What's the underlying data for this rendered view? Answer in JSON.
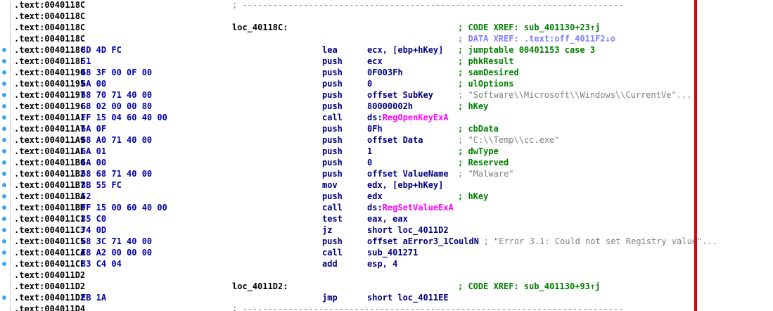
{
  "colors": {
    "address": "#000000",
    "bytes": "#0000aa",
    "instruction": "#000080",
    "api_name": "#ff00ff",
    "comment": "#008000",
    "string_comment": "#808080",
    "marker_dot": "#3aa6ee",
    "right_border": "#e00000"
  },
  "lines": [
    {
      "addr": ".text:0040118C",
      "sep": "; ---------------------------------------------------------------------------"
    },
    {
      "addr": ".text:0040118C"
    },
    {
      "addr": ".text:0040118C",
      "label": "loc_40118C:",
      "comment": "; CODE XREF: sub_401130+23↑j"
    },
    {
      "addr": ".text:0040118C",
      "comment": "; DATA XREF: .text:off_4011F2↓o",
      "comment_style": "xref"
    },
    {
      "addr": ".text:0040118C",
      "dot": true,
      "bytes": "8D 4D FC",
      "mnem": "lea",
      "ops": "ecx, [ebp+hKey]",
      "comment": "; jumptable 00401153 case 3"
    },
    {
      "addr": ".text:0040118F",
      "dot": true,
      "bytes": "51",
      "mnem": "push",
      "ops": "ecx",
      "comment": "; phkResult"
    },
    {
      "addr": ".text:00401190",
      "dot": true,
      "bytes": "68 3F 00 0F 00",
      "mnem": "push",
      "ops": "0F003Fh",
      "comment": "; samDesired"
    },
    {
      "addr": ".text:00401195",
      "dot": true,
      "bytes": "6A 00",
      "mnem": "push",
      "ops": "0",
      "comment": "; ulOptions"
    },
    {
      "addr": ".text:00401197",
      "dot": true,
      "bytes": "68 70 71 40 00",
      "mnem": "push",
      "ops": "offset SubKey",
      "comment": "; \"Software\\\\Microsoft\\\\Windows\\\\CurrentVe\"...",
      "comment_style": "string"
    },
    {
      "addr": ".text:0040119C",
      "dot": true,
      "bytes": "68 02 00 00 80",
      "mnem": "push",
      "ops": "80000002h",
      "comment": "; hKey"
    },
    {
      "addr": ".text:004011A1",
      "dot": true,
      "bytes": "FF 15 04 60 40 00",
      "mnem": "call",
      "ops": "ds:RegOpenKeyExA"
    },
    {
      "addr": ".text:004011A7",
      "dot": true,
      "bytes": "6A 0F",
      "mnem": "push",
      "ops": "0Fh",
      "comment": "; cbData"
    },
    {
      "addr": ".text:004011A9",
      "dot": true,
      "bytes": "68 A0 71 40 00",
      "mnem": "push",
      "ops": "offset Data",
      "comment": "; \"C:\\\\Temp\\\\cc.exe\"",
      "comment_style": "string"
    },
    {
      "addr": ".text:004011AE",
      "dot": true,
      "bytes": "6A 01",
      "mnem": "push",
      "ops": "1",
      "comment": "; dwType"
    },
    {
      "addr": ".text:004011B0",
      "dot": true,
      "bytes": "6A 00",
      "mnem": "push",
      "ops": "0",
      "comment": "; Reserved"
    },
    {
      "addr": ".text:004011B2",
      "dot": true,
      "bytes": "68 68 71 40 00",
      "mnem": "push",
      "ops": "offset ValueName",
      "comment": "; \"Malware\"",
      "comment_style": "string"
    },
    {
      "addr": ".text:004011B7",
      "dot": true,
      "bytes": "8B 55 FC",
      "mnem": "mov",
      "ops": "edx, [ebp+hKey]"
    },
    {
      "addr": ".text:004011BA",
      "dot": true,
      "bytes": "52",
      "mnem": "push",
      "ops": "edx",
      "comment": "; hKey"
    },
    {
      "addr": ".text:004011BB",
      "dot": true,
      "bytes": "FF 15 00 60 40 00",
      "mnem": "call",
      "ops": "ds:RegSetValueExA"
    },
    {
      "addr": ".text:004011C1",
      "dot": true,
      "bytes": "85 C0",
      "mnem": "test",
      "ops": "eax, eax"
    },
    {
      "addr": ".text:004011C3",
      "dot": true,
      "bytes": "74 0D",
      "mnem": "jz",
      "ops": "short loc_4011D2"
    },
    {
      "addr": ".text:004011C5",
      "dot": true,
      "bytes": "68 3C 71 40 00",
      "mnem": "push",
      "ops": "offset aError3_1CouldN",
      "comment": "; \"Error 3.1: Could not set Registry value\"...",
      "comment_style": "string"
    },
    {
      "addr": ".text:004011CA",
      "dot": true,
      "bytes": "E8 A2 00 00 00",
      "mnem": "call",
      "ops": "sub_401271"
    },
    {
      "addr": ".text:004011CF",
      "dot": true,
      "bytes": "83 C4 04",
      "mnem": "add",
      "ops": "esp, 4"
    },
    {
      "addr": ".text:004011D2"
    },
    {
      "addr": ".text:004011D2",
      "label": "loc_4011D2:",
      "comment": "; CODE XREF: sub_401130+93↑j"
    },
    {
      "addr": ".text:004011D2",
      "dot": true,
      "bytes": "EB 1A",
      "mnem": "jmp",
      "ops": "short loc_4011EE"
    },
    {
      "addr": ".text:004011D4",
      "sep": "; ---------------------------------------------------------------------------"
    }
  ]
}
